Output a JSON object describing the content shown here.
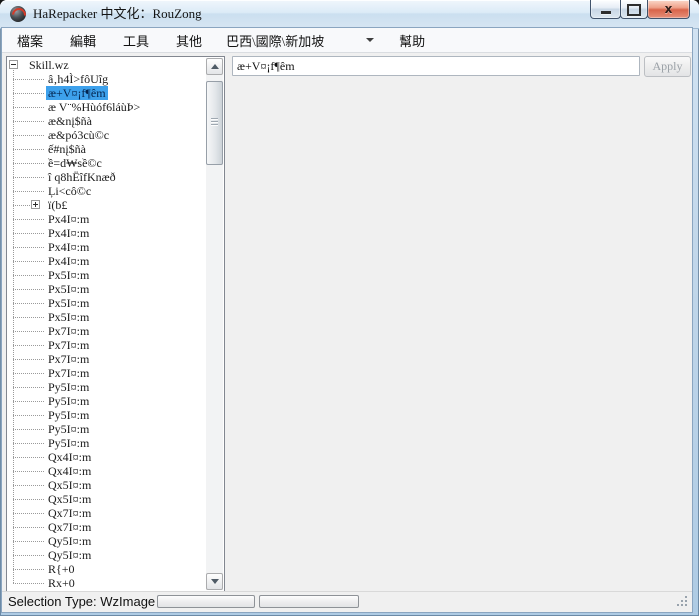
{
  "window": {
    "title": "HaRepacker 中文化：RouZong",
    "icons": {
      "app": "app-icon",
      "minimize": "minimize-icon",
      "maximize": "maximize-icon",
      "close": "close-icon"
    }
  },
  "menu": {
    "file": "檔案",
    "edit": "編輯",
    "tools": "工具",
    "others": "其他",
    "region_combo_value": "巴西\\國際\\新加坡",
    "help": "幫助"
  },
  "editor": {
    "value": "æ+V¤¡f¶êm",
    "apply_label": "Apply",
    "apply_enabled": false
  },
  "tree": {
    "root_label": "Skill.wz",
    "root_expanded": true,
    "items": [
      {
        "label": "â‚h4Ì>fôUîg"
      },
      {
        "label": "æ+V¤¡f¶êm",
        "selected": true
      },
      {
        "label": "æ V¨%Hùóf6láùÞ>"
      },
      {
        "label": "æ&nį$ñà"
      },
      {
        "label": "æ&pó3cù©c"
      },
      {
        "label": "ế#nį$ñà"
      },
      {
        "label": "ề=d₩sề©c"
      },
      {
        "label": "î q8hËîfKnæð"
      },
      {
        "label": "Ļi<cô©c"
      },
      {
        "label": "ï(b£",
        "box": "plus"
      },
      {
        "label": "Px4I¤:m"
      },
      {
        "label": "Px4I¤:m"
      },
      {
        "label": "Px4I¤:m"
      },
      {
        "label": "Px4I¤:m"
      },
      {
        "label": "Px5I¤:m"
      },
      {
        "label": "Px5I¤:m"
      },
      {
        "label": "Px5I¤:m"
      },
      {
        "label": "Px5I¤:m"
      },
      {
        "label": "Px7I¤:m"
      },
      {
        "label": "Px7I¤:m"
      },
      {
        "label": "Px7I¤:m"
      },
      {
        "label": "Px7I¤:m"
      },
      {
        "label": "Py5I¤:m"
      },
      {
        "label": "Py5I¤:m"
      },
      {
        "label": "Py5I¤:m"
      },
      {
        "label": "Py5I¤:m"
      },
      {
        "label": "Py5I¤:m"
      },
      {
        "label": "Qx4I¤:m"
      },
      {
        "label": "Qx4I¤:m"
      },
      {
        "label": "Qx5I¤:m"
      },
      {
        "label": "Qx5I¤:m"
      },
      {
        "label": "Qx7I¤:m"
      },
      {
        "label": "Qx7I¤:m"
      },
      {
        "label": "Qy5I¤:m"
      },
      {
        "label": "Qy5I¤:m"
      },
      {
        "label": "R{+0"
      },
      {
        "label": "Rx+0"
      }
    ]
  },
  "statusbar": {
    "selection_type": "Selection Type: WzImage"
  },
  "colors": {
    "selection_highlight": "#3da1ec",
    "close_button_red": "#d8644a",
    "titlebar_blue": "#d6e5f2",
    "panel_background": "#f0f0f0"
  }
}
